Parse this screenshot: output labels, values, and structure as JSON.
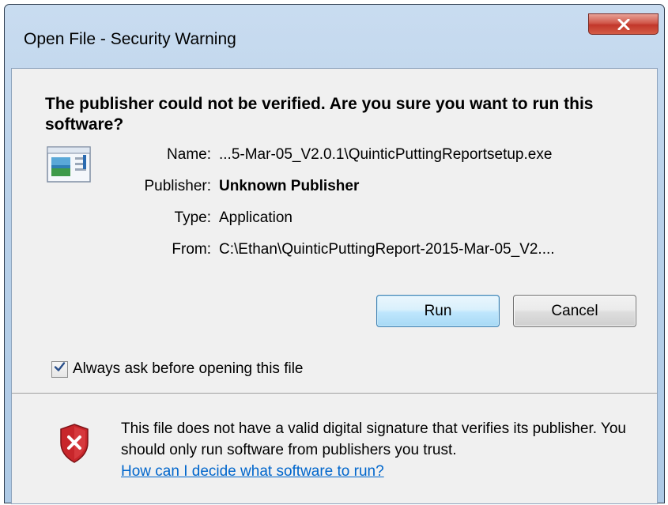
{
  "window": {
    "title": "Open File - Security Warning"
  },
  "headline": "The publisher could not be verified.  Are you sure you want to run this software?",
  "file_info": {
    "name_label": "Name:",
    "name_value": "...5-Mar-05_V2.0.1\\QuinticPuttingReportsetup.exe",
    "publisher_label": "Publisher:",
    "publisher_value": "Unknown Publisher",
    "type_label": "Type:",
    "type_value": "Application",
    "from_label": "From:",
    "from_value": "C:\\Ethan\\QuinticPuttingReport-2015-Mar-05_V2...."
  },
  "buttons": {
    "run_label": "Run",
    "cancel_label": "Cancel"
  },
  "checkbox": {
    "label": "Always ask before opening this file",
    "checked": true
  },
  "warning": {
    "text": "This file does not have a valid digital signature that verifies its publisher.  You should only run software from publishers you trust.",
    "link": "How can I decide what software to run?"
  },
  "icons": {
    "close": "close-icon",
    "application": "application-icon",
    "shield": "security-shield-icon",
    "check": "check-icon"
  },
  "colors": {
    "close_button": "#c7402f",
    "link": "#0066cc",
    "shield": "#c8262b"
  }
}
